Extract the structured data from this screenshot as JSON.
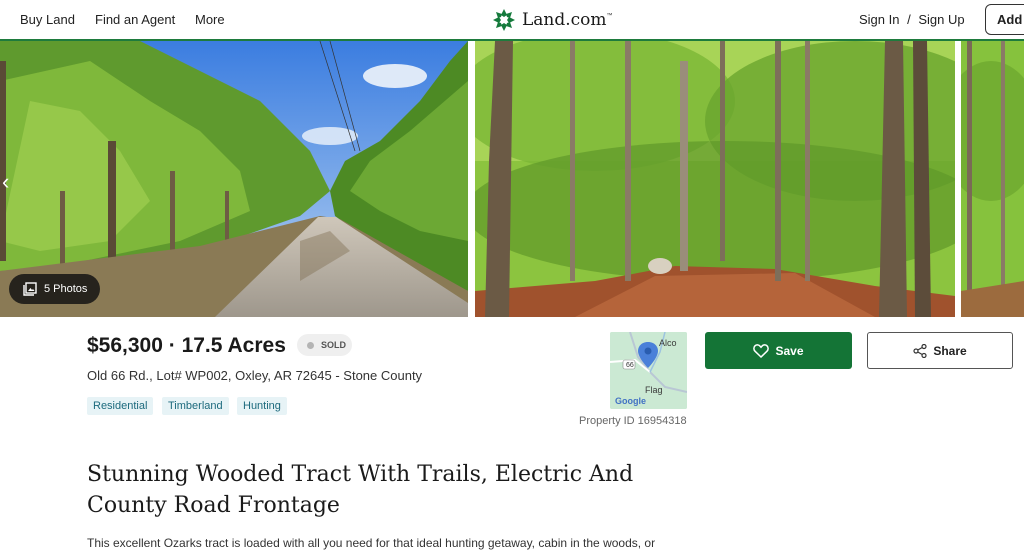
{
  "header": {
    "nav": [
      "Buy Land",
      "Find an Agent",
      "More"
    ],
    "logo_text": "Land.com",
    "logo_tm": "™",
    "sign_in": "Sign In",
    "separator": "/",
    "sign_up": "Sign Up",
    "add_label": "Add"
  },
  "gallery": {
    "photo_count_label": "5 Photos",
    "prev_arrow": "‹"
  },
  "listing": {
    "price_acres": "$56,300 · 17.5 Acres",
    "status": "SOLD",
    "address": "Old 66 Rd., Lot# WP002, Oxley, AR 72645 - Stone County",
    "tags": [
      "Residential",
      "Timberland",
      "Hunting"
    ],
    "property_id": "Property ID 16954318",
    "map": {
      "label_alco": "Alco",
      "label_flag": "Flag",
      "route": "66",
      "google": "Google"
    },
    "save_label": "Save",
    "share_label": "Share",
    "headline": "Stunning Wooded Tract With Trails, Electric And County Road Frontage",
    "description": "This excellent Ozarks tract is loaded with all you need for that ideal hunting getaway, cabin in the woods, or"
  },
  "colors": {
    "brand_green": "#147436",
    "tag_bg": "#e7f3f6",
    "tag_text": "#1c6a7d"
  },
  "icons": [
    "chevron-left-icon",
    "photos-icon",
    "heart-icon",
    "share-icon",
    "map-pin-icon",
    "logo-icon"
  ]
}
